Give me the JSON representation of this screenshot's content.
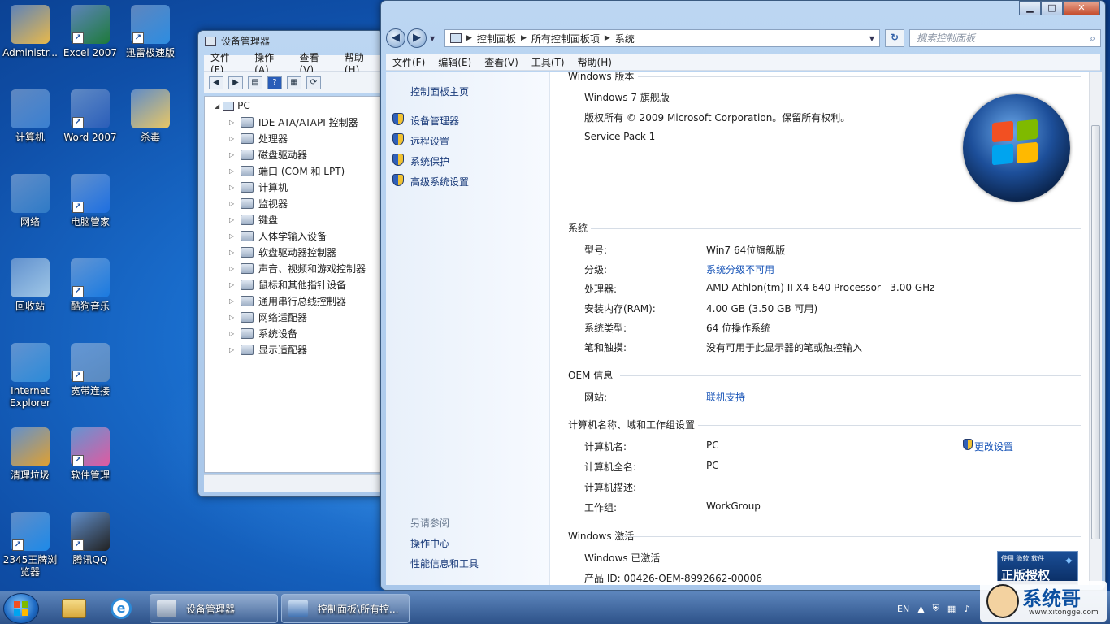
{
  "desktop": {
    "icons": [
      {
        "label": "Administr...",
        "icon": "user-folder-icon",
        "color": "#e8b84a"
      },
      {
        "label": "Excel 2007",
        "icon": "excel-icon",
        "color": "#1e7a3a"
      },
      {
        "label": "迅雷极速版",
        "icon": "thunder-icon",
        "color": "#2d8ce0"
      },
      {
        "label": "计算机",
        "icon": "computer-icon",
        "color": "#3a7fd0"
      },
      {
        "label": "Word 2007",
        "icon": "word-icon",
        "color": "#2a5db8"
      },
      {
        "label": "杀毒",
        "icon": "folder-icon",
        "color": "#e8c664"
      },
      {
        "label": "网络",
        "icon": "network-icon",
        "color": "#2f7ac6"
      },
      {
        "label": "电脑管家",
        "icon": "pc-manager-icon",
        "color": "#1e6fe0"
      },
      {
        "label": "回收站",
        "icon": "recycle-bin-icon",
        "color": "#9fc6e6"
      },
      {
        "label": "酷狗音乐",
        "icon": "kugou-icon",
        "color": "#1a7ae0"
      },
      {
        "label": "Internet Explorer",
        "icon": "ie-icon",
        "color": "#2c8ad8"
      },
      {
        "label": "宽带连接",
        "icon": "broadband-icon",
        "color": "#5a8ac0"
      },
      {
        "label": "清理垃圾",
        "icon": "cleaner-icon",
        "color": "#e0a030"
      },
      {
        "label": "软件管理",
        "icon": "software-icon",
        "color": "#e05aa0"
      },
      {
        "label": "2345王牌浏览器",
        "icon": "browser-2345-icon",
        "color": "#1e8ae8"
      },
      {
        "label": "腾讯QQ",
        "icon": "qq-icon",
        "color": "#222222"
      }
    ]
  },
  "devmgr": {
    "title": "设备管理器",
    "menu": [
      "文件(F)",
      "操作(A)",
      "查看(V)",
      "帮助(H)"
    ],
    "root": "PC",
    "items": [
      "IDE ATA/ATAPI 控制器",
      "处理器",
      "磁盘驱动器",
      "端口 (COM 和 LPT)",
      "计算机",
      "监视器",
      "键盘",
      "人体学输入设备",
      "软盘驱动器控制器",
      "声音、视频和游戏控制器",
      "鼠标和其他指针设备",
      "通用串行总线控制器",
      "网络适配器",
      "系统设备",
      "显示适配器"
    ]
  },
  "cpanel": {
    "breadcrumb": [
      "控制面板",
      "所有控制面板项",
      "系统"
    ],
    "search_placeholder": "搜索控制面板",
    "menu": [
      "文件(F)",
      "编辑(E)",
      "查看(V)",
      "工具(T)",
      "帮助(H)"
    ],
    "left": {
      "home": "控制面板主页",
      "links": [
        "设备管理器",
        "远程设置",
        "系统保护",
        "高级系统设置"
      ],
      "see_also_title": "另请参阅",
      "see_also": [
        "操作中心",
        "性能信息和工具"
      ]
    },
    "edition": {
      "title": "Windows 版本",
      "name": "Windows 7 旗舰版",
      "copyright": "版权所有 © 2009 Microsoft Corporation。保留所有权利。",
      "sp": "Service Pack 1"
    },
    "system": {
      "title": "系统",
      "rows": [
        {
          "label": "型号:",
          "value": "Win7 64位旗舰版",
          "link": false
        },
        {
          "label": "分级:",
          "value": "系统分级不可用",
          "link": true
        },
        {
          "label": "处理器:",
          "value": "AMD Athlon(tm) II X4 640 Processor   3.00 GHz",
          "link": false
        },
        {
          "label": "安装内存(RAM):",
          "value": "4.00 GB (3.50 GB 可用)",
          "link": false
        },
        {
          "label": "系统类型:",
          "value": "64 位操作系统",
          "link": false
        },
        {
          "label": "笔和触摸:",
          "value": "没有可用于此显示器的笔或触控输入",
          "link": false
        }
      ]
    },
    "oem": {
      "title": "OEM 信息",
      "label": "网站:",
      "value": "联机支持"
    },
    "computer": {
      "title": "计算机名称、域和工作组设置",
      "change": "更改设置",
      "rows": [
        {
          "label": "计算机名:",
          "value": "PC"
        },
        {
          "label": "计算机全名:",
          "value": "PC"
        },
        {
          "label": "计算机描述:",
          "value": ""
        },
        {
          "label": "工作组:",
          "value": "WorkGroup"
        }
      ]
    },
    "activation": {
      "title": "Windows 激活",
      "status": "Windows 已激活",
      "product_id": "产品 ID: 00426-OEM-8992662-00006",
      "badge_small": "使用 微软 软件",
      "badge_big": "正版授权"
    }
  },
  "taskbar": {
    "tasks": [
      "设备管理器",
      "控制面板\\所有控..."
    ],
    "lang": "EN"
  },
  "watermark": {
    "big": "系统哥",
    "small": "www.xitongge.com"
  }
}
